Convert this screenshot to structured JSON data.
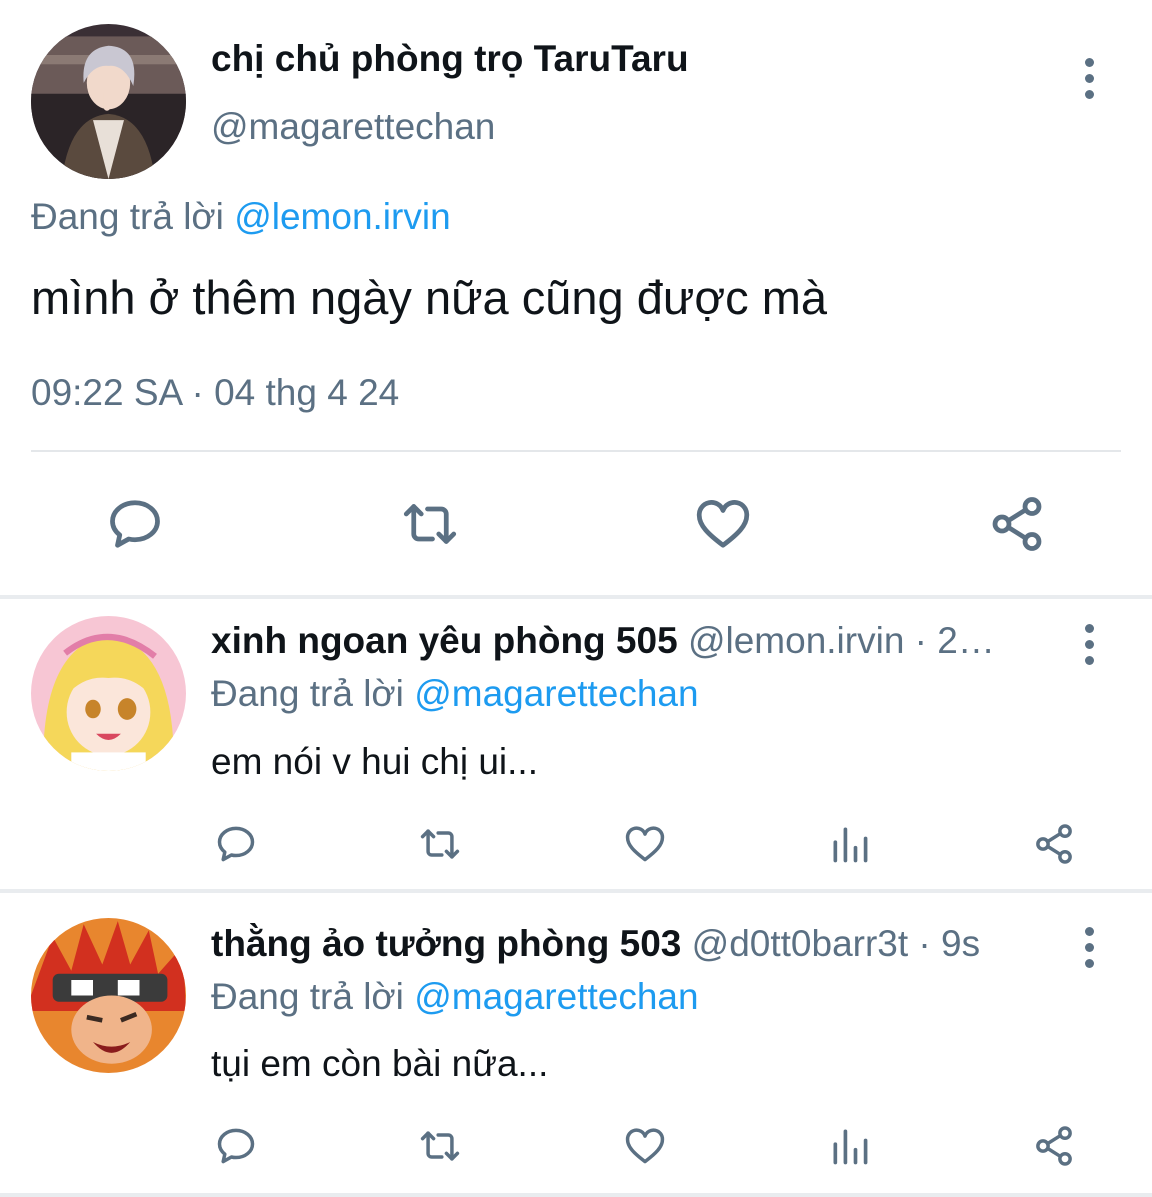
{
  "main_tweet": {
    "author_name": "chị chủ phòng trọ TaruTaru",
    "author_handle": "@magarettechan",
    "replying_label": "Đang trả lời",
    "replying_to": "@lemon.irvin",
    "text": "mình ở thêm ngày nữa cũng được mà",
    "timestamp": "09:22 SA · 04 thg 4 24",
    "actions": [
      "reply-icon",
      "retweet-icon",
      "like-icon",
      "share-icon"
    ]
  },
  "replies": [
    {
      "author_name": "xinh ngoan yêu phòng 505",
      "header_meta": "@lemon.irvin · 2…",
      "replying_label": "Đang trả lời",
      "replying_to": "@magarettechan",
      "text": "em nói v hui chị ui...",
      "actions": [
        "reply-icon",
        "retweet-icon",
        "like-icon",
        "views-icon",
        "share-icon"
      ]
    },
    {
      "author_name": "thằng ảo tưởng phòng 503",
      "header_meta": "@d0tt0barr3t · 9s",
      "replying_label": "Đang trả lời",
      "replying_to": "@magarettechan",
      "text": "tụi em còn bài nữa...",
      "actions": [
        "reply-icon",
        "retweet-icon",
        "like-icon",
        "views-icon",
        "share-icon"
      ]
    }
  ],
  "colors": {
    "text_primary": "#0f1419",
    "text_secondary": "#5b7083",
    "mention": "#1d9bf0",
    "divider": "#e9ecef"
  }
}
